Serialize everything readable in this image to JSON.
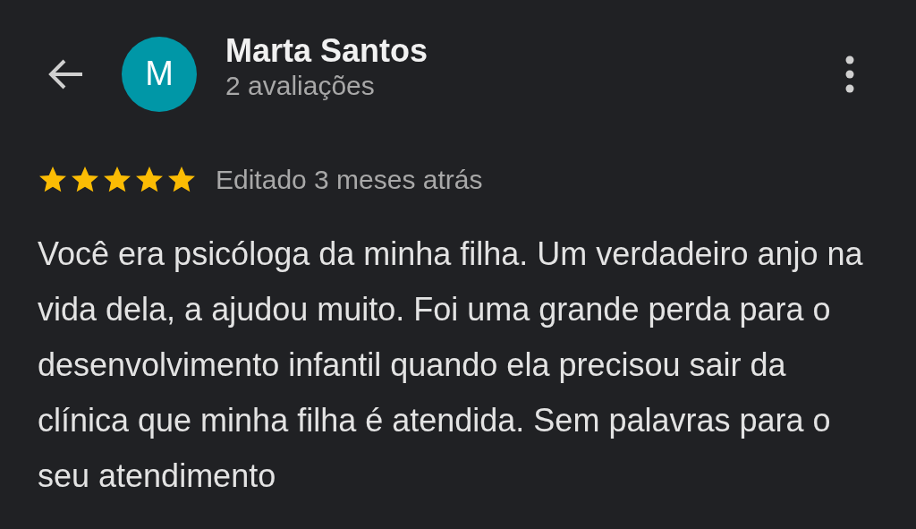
{
  "header": {
    "avatar_letter": "M",
    "name": "Marta Santos",
    "subtitle": "2 avaliações"
  },
  "review": {
    "stars": 5,
    "date": "Editado 3 meses atrás",
    "text": "Você era psicóloga da minha filha. Um verdadeiro anjo na vida dela, a ajudou muito. Foi uma grande perda para o desenvolvimento infantil quando ela precisou sair da clínica que minha filha é atendida. Sem palavras para o seu atendimento"
  }
}
